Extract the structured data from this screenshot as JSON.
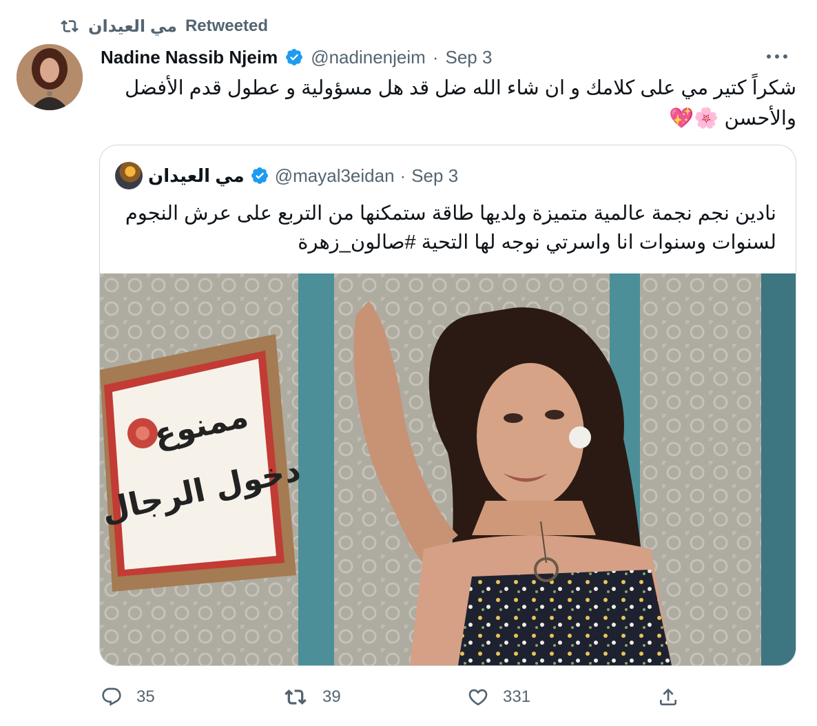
{
  "retweet_banner": {
    "user": "مي العيدان",
    "label": "Retweeted"
  },
  "tweet": {
    "author_name": "Nadine Nassib Njeim",
    "handle": "@nadinenjeim",
    "separator": "·",
    "date": "Sep 3",
    "text": "شكراً كتير مي على كلامك و ان شاء الله ضل قد هل مسؤولية و عطول قدم الأفضل والأحسن 🌸💖"
  },
  "quoted_tweet": {
    "author_name": "مي العيدان",
    "handle": "@mayal3eidan",
    "separator": "·",
    "date": "Sep 3",
    "text": "نادين نجم نجمة عالمية متميزة ولديها طاقة ستمكنها من التربع على عرش النجوم لسنوات وسنوات انا واسرتي نوجه لها التحية #صالون_زهرة",
    "image_sign_line1": "ممنوع",
    "image_sign_line2": "دخول الرجال"
  },
  "actions": {
    "replies": "35",
    "retweets": "39",
    "likes": "331"
  },
  "colors": {
    "secondary_text": "#536471",
    "verified": "#1d9bf0",
    "border": "#cfd9de"
  }
}
